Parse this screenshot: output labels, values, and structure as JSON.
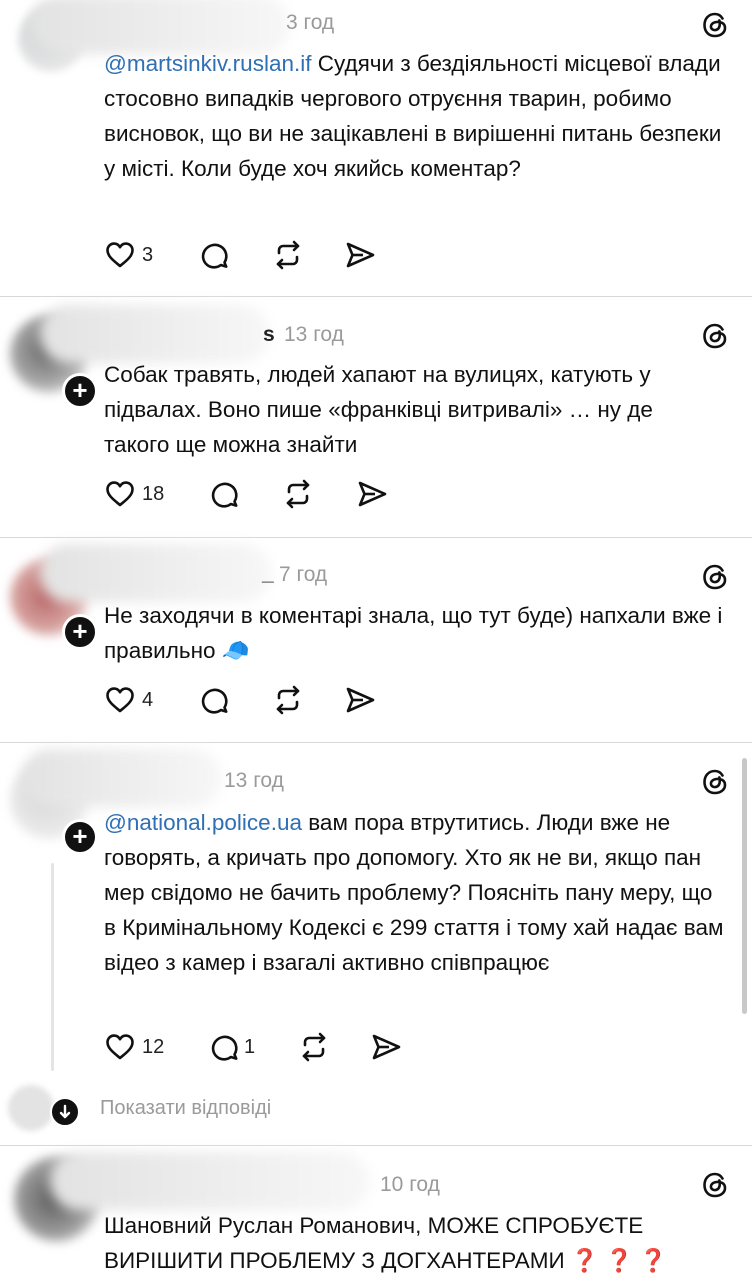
{
  "icons": {
    "like": "heart-icon",
    "reply": "comment-bubble-icon",
    "repost": "repost-arrows-icon",
    "share": "send-paper-plane-icon",
    "app": "threads-logo-icon"
  },
  "colors": {
    "mention": "#2f6fb3",
    "time": "#9a9a9a"
  },
  "posts": [
    {
      "name_tail": "",
      "time": "3 год",
      "mention": "@martsinkiv.ruslan.if",
      "text": " Судячи з бездіяльності місцевої влади стосовно випадків чергового отруєння тварин, робимо висновок, що ви не зацікавлені в вирішенні питань безпеки у місті. Коли буде хоч якийсь коментар?",
      "likes": "3",
      "replies": ""
    },
    {
      "name_tail": "s",
      "time": "13 год",
      "mention": "",
      "text": "Собак травять, людей хапают на вулицях, катують у підвалах. Воно пише «франківці витривалі» …  ну де такого ще можна знайти",
      "likes": "18",
      "replies": ""
    },
    {
      "name_tail": "_",
      "time": "7 год",
      "mention": "",
      "text": "Не заходячи в коментарі знала, що тут буде) напхали вже і правильно 🧢",
      "likes": "4",
      "replies": ""
    },
    {
      "name_tail": "",
      "time": "13 год",
      "mention": "@national.police.ua",
      "text": " вам пора втрутитись. Люди вже не говорять, а кричать про допомогу. Хто як не ви, якщо пан мер свідомо не бачить проблему? Поясніть пану меру, що в Кримінальному Кодексі є 299 стаття і тому хай надає вам відео з камер і взагалі активно співпрацює",
      "likes": "12",
      "replies": "1"
    },
    {
      "name_tail": "",
      "time": "10 год",
      "mention": "",
      "text": "Шановний Руслан Романович, МОЖЕ СПРОБУЄТЕ ВИРІШИТИ ПРОБЛЕМУ З ДОГХАНТЕРАМИ ❓ ❓ ❓",
      "likes": "",
      "replies": ""
    }
  ],
  "show_replies": "Показати відповіді"
}
